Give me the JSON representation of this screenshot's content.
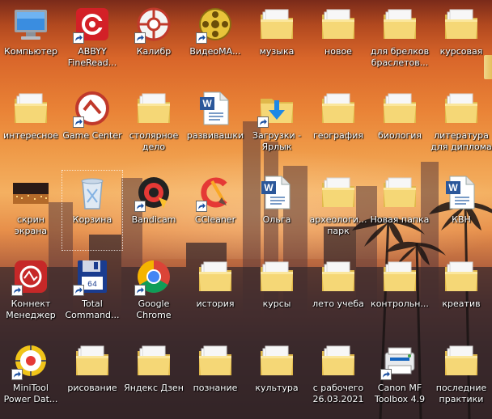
{
  "desktop": {
    "icons": [
      {
        "label": "Компьютер",
        "icon": "computer-icon",
        "shortcut": false
      },
      {
        "label": "ABBYY FineRead...",
        "icon": "abbyy-finereader-icon",
        "shortcut": true
      },
      {
        "label": "Калибр",
        "icon": "calibre-icon",
        "shortcut": true
      },
      {
        "label": "ВидеоМА...",
        "icon": "videomaster-icon",
        "shortcut": true
      },
      {
        "label": "музыка",
        "icon": "folder-icon",
        "shortcut": false
      },
      {
        "label": "новое",
        "icon": "folder-icon",
        "shortcut": false
      },
      {
        "label": "для брелков браслетов...",
        "icon": "folder-icon",
        "shortcut": false
      },
      {
        "label": "курсовая",
        "icon": "folder-icon",
        "shortcut": false
      },
      {
        "label": "интересное",
        "icon": "folder-icon",
        "shortcut": false
      },
      {
        "label": "Game Center",
        "icon": "game-center-icon",
        "shortcut": true
      },
      {
        "label": "столярное дело",
        "icon": "folder-icon",
        "shortcut": false
      },
      {
        "label": "развивашки",
        "icon": "word-document-icon",
        "shortcut": false
      },
      {
        "label": "Загрузки - Ярлык",
        "icon": "downloads-folder-icon",
        "shortcut": true
      },
      {
        "label": "география",
        "icon": "folder-icon",
        "shortcut": false
      },
      {
        "label": "биология",
        "icon": "folder-icon",
        "shortcut": false
      },
      {
        "label": "литература для диплома",
        "icon": "folder-icon",
        "shortcut": false
      },
      {
        "label": "скрин экрана",
        "icon": "image-thumbnail-icon",
        "shortcut": false
      },
      {
        "label": "Корзина",
        "icon": "recycle-bin-icon",
        "shortcut": false
      },
      {
        "label": "Bandicam",
        "icon": "bandicam-icon",
        "shortcut": true
      },
      {
        "label": "CCleaner",
        "icon": "ccleaner-icon",
        "shortcut": true
      },
      {
        "label": "Ольга",
        "icon": "word-document-icon",
        "shortcut": false
      },
      {
        "label": "археологи... парк",
        "icon": "folder-icon",
        "shortcut": false
      },
      {
        "label": "Новая папка",
        "icon": "folder-icon",
        "shortcut": false
      },
      {
        "label": "КВН",
        "icon": "word-document-icon",
        "shortcut": false
      },
      {
        "label": "Коннект Менеджер",
        "icon": "connect-manager-icon",
        "shortcut": true
      },
      {
        "label": "Total Command...",
        "icon": "total-commander-icon",
        "shortcut": true
      },
      {
        "label": "Google Chrome",
        "icon": "chrome-icon",
        "shortcut": true
      },
      {
        "label": "история",
        "icon": "folder-icon",
        "shortcut": false
      },
      {
        "label": "курсы",
        "icon": "folder-icon",
        "shortcut": false
      },
      {
        "label": "лето учеба",
        "icon": "folder-icon",
        "shortcut": false
      },
      {
        "label": "контрольн...",
        "icon": "folder-icon",
        "shortcut": false
      },
      {
        "label": "креатив",
        "icon": "folder-icon",
        "shortcut": false
      },
      {
        "label": "MiniTool Power Dat...",
        "icon": "minitool-icon",
        "shortcut": true
      },
      {
        "label": "рисование",
        "icon": "folder-icon",
        "shortcut": false
      },
      {
        "label": "Яндекс Дзен",
        "icon": "folder-icon",
        "shortcut": false
      },
      {
        "label": "познание",
        "icon": "folder-icon",
        "shortcut": false
      },
      {
        "label": "культура",
        "icon": "folder-icon",
        "shortcut": false
      },
      {
        "label": "с рабочего 26.03.2021",
        "icon": "folder-icon",
        "shortcut": false
      },
      {
        "label": "Canon MF Toolbox 4.9",
        "icon": "canon-toolbox-icon",
        "shortcut": true
      },
      {
        "label": "последние практики",
        "icon": "folder-icon",
        "shortcut": false
      }
    ],
    "selected_label": "Корзина"
  }
}
